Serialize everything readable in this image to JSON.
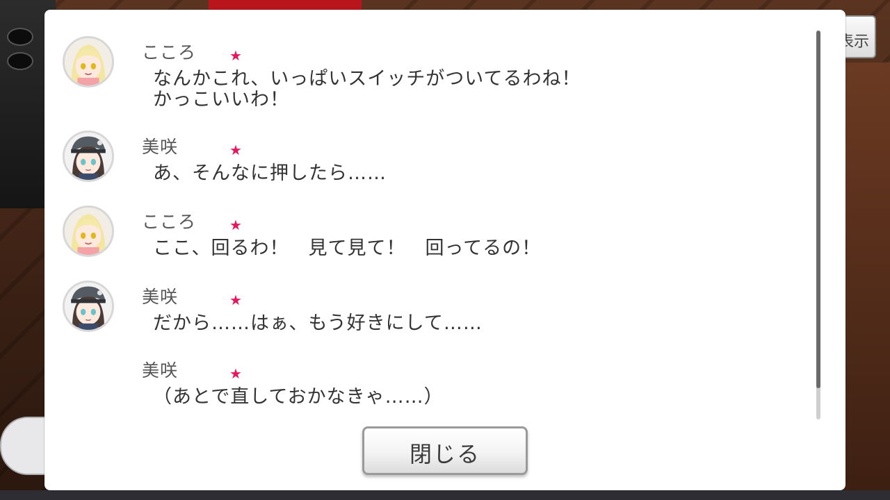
{
  "background": {
    "side_button_label": "表示"
  },
  "log": {
    "star_glyph": "★",
    "star_color": "#e8175d",
    "entries": [
      {
        "speaker": "こころ",
        "avatar": "kokoro-avatar",
        "lines": [
          "なんかこれ、いっぱいスイッチがついてるわね！",
          "かっこいいわ！"
        ]
      },
      {
        "speaker": "美咲",
        "avatar": "misaki-avatar",
        "lines": [
          "あ、そんなに押したら……"
        ]
      },
      {
        "speaker": "こころ",
        "avatar": "kokoro-avatar",
        "lines": [
          "ここ、回るわ！　見て見て！　回ってるの！"
        ]
      },
      {
        "speaker": "美咲",
        "avatar": "misaki-avatar",
        "lines": [
          "だから……はぁ、もう好きにして……"
        ]
      },
      {
        "speaker": "美咲",
        "avatar": null,
        "lines": [
          "（あとで直しておかなきゃ……）"
        ]
      }
    ]
  },
  "close_button": {
    "label": "閉じる"
  }
}
